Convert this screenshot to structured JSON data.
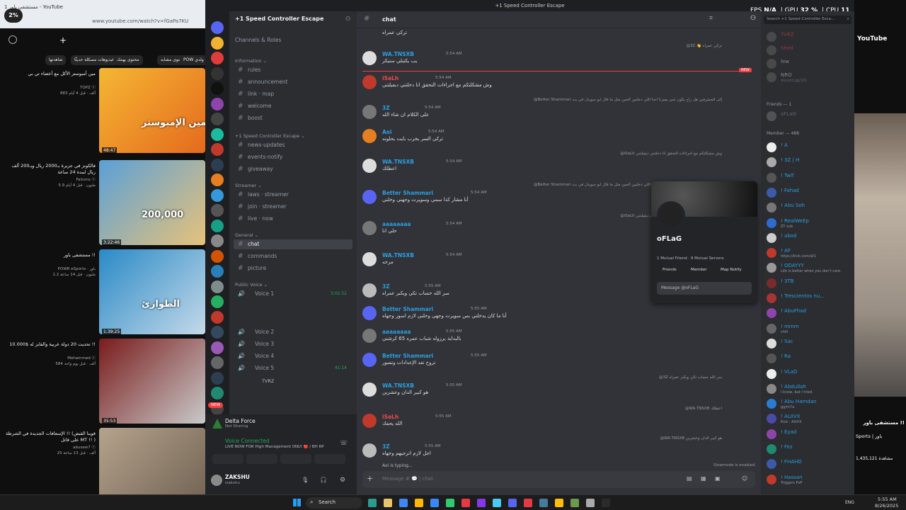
{
  "yt_left": {
    "percent": "2%",
    "tab_title": "مستشفى باور 1 - YouTube",
    "url": "www.youtube.com/watch?v=fGaPa7KU",
    "chips": [
      "شاهدتها",
      "فيديوهات مسكلة حديثًا",
      "محتوى يهمك",
      "محتوى مشابه",
      "POW ولدي"
    ],
    "videos": [
      {
        "duration": "48:47",
        "title": "مين أمبوستر الأكل مع أعضاء تي بي",
        "channel": "TOPZ ⓔ",
        "meta": "883 ألف · قبل 4 أيام",
        "thumb_text": "مين الإمبوستر!"
      },
      {
        "duration": "3:22:46",
        "title": "فالكونز في جزيرة بـ2000 ريال وبـ200 ألف ريال لمدة 24 ساعة",
        "channel": "Falcons ⓔ",
        "meta": "5.9 مليون · قبل 4 أيام",
        "thumb_text": "200,000"
      },
      {
        "duration": "1:39:25",
        "title": "مستشفى باور !!",
        "channel": "POWR eSports · باور",
        "meta": "1.2 مليون · قبل 14 ساعة",
        "thumb_text": "الطوارئ"
      },
      {
        "duration": "35:53",
        "title": "تحديت 20 دولة عربية والفايز له $10.000 !!",
        "channel": "Mohammed ⓔ",
        "meta": "584 ألف · قبل يوم واحد",
        "thumb_text": ""
      },
      {
        "duration": "",
        "title": "الإسعافات الجديدة في الشرطة !! (قوبنا القبض على قاتل MT !! )",
        "channel": "abusew7 ⓔ",
        "meta": "25 ألف · قبل 13 ساعة",
        "thumb_text": ""
      }
    ]
  },
  "discord": {
    "window_title": "+1 Speed Controller Escape",
    "server_name": "+1 Speed Controller Escape",
    "channels_roles": "Channels & Roles",
    "categories": [
      {
        "name": "Information ⌄",
        "channels": [
          "rules",
          "announcement",
          "link · map",
          "welcome",
          "boost"
        ]
      },
      {
        "name": "+1 Speed Controller Escape ⌄",
        "channels": [
          "news-updates",
          "events-notify",
          "giveaway"
        ]
      },
      {
        "name": "Streamer ⌄",
        "channels": [
          "laws · streamer",
          "join · streamer",
          "live · now"
        ]
      },
      {
        "name": "General ⌄",
        "channels": [
          "chat",
          "commands",
          "picture"
        ]
      }
    ],
    "public_voice": "Public Voice ⌄",
    "voice": [
      {
        "name": "Voice 1",
        "time": "3:02:52"
      },
      {
        "name": "Voice 2",
        "time": ""
      },
      {
        "name": "Voice 3",
        "time": ""
      },
      {
        "name": "Voice 4",
        "time": ""
      },
      {
        "name": "Voice 5",
        "time": "41:14"
      }
    ],
    "voice_user": "TVRZ",
    "game": {
      "name": "Delta Force",
      "status": "Not Sharing"
    },
    "voice_connected": "Voice Connected",
    "voice_sub": "LIVE NOW FOR High Management ONLY 🔴 / BH RP",
    "user": {
      "name": "ZAKSHU",
      "handle": "izakshu"
    },
    "new_badge": "NEW",
    "chat_channel": "chat",
    "messages": [
      {
        "reply": "",
        "name": "",
        "time": "",
        "text": "تركي عمراه",
        "color": "#dbdee1"
      },
      {
        "reply": "@3Z 👋 تركي عمراه",
        "name": "WA.TNSXB",
        "time": "5:54 AM",
        "text": "يب يكتبلي ستيكر",
        "color": "#2b9fdf"
      },
      {
        "reply": "",
        "name": "iSaLh",
        "time": "5:54 AM",
        "text": "وش مشكلتكم مع اجراءات التحقق انا دخلتني ديفيلتني",
        "color": "#f04a4a"
      },
      {
        "reply": "@Better Shammari إلى المشرفين هل راح يكون شي يميزنا احنا اللي دخلنين الحين مثل ما قال أبو سويدل في بث",
        "name": "3Z",
        "time": "5:54 AM",
        "text": "على الكلام ان شاء الله",
        "color": "#2b9fdf"
      },
      {
        "reply": "",
        "name": "Aoi",
        "time": "5:54 AM",
        "text": "تركي السر يخرب بايت يحلونه",
        "color": "#2b9fdf"
      },
      {
        "reply": "@iSaLh وش مشكلتكم مع اجراءات التحقق انا دخلتني ديفيلتني",
        "name": "WA.TNSXB",
        "time": "5:54 AM",
        "text": "اعطلك",
        "color": "#2b9fdf"
      },
      {
        "reply": "@Better Shammari إلى المشرفين هل راح يكون شي يميزنا احنا اللي دخلنين الحين مثل ما قال أبو سويدل في بث",
        "name": "Better Shammari",
        "time": "5:54 AM",
        "text": "أنا مشار كذا سمي وسويرت وجهني وخلني",
        "color": "#2b9fdf"
      },
      {
        "reply": "@iSaLh وش مشكلتكم مع اجراءات التحقق انا دخلتني ديفيلتني",
        "name": "aaaaaaaa",
        "time": "5:54 AM",
        "text": "حلي انا",
        "color": "#2b9fdf"
      },
      {
        "reply": "@Aoi تركي السر يخرب بايت يحلونه",
        "name": "WA.TNSXB",
        "time": "5:54 AM",
        "text": "مرحه",
        "color": "#2b9fdf"
      },
      {
        "reply": "@WA.TNSXB يب يكتبلي ستيكر",
        "name": "3Z",
        "time": "5:55 AM",
        "text": "سر الله حساب تكي ويكبر عمراه",
        "color": "#2b9fdf"
      },
      {
        "reply": "",
        "name": "Better Shammari",
        "time": "5:55 AM",
        "text": "أنا ما كان يدخلني بس سويرت وجهي وخلني لازم اسور وجهاه",
        "color": "#2b9fdf"
      },
      {
        "reply": "",
        "name": "aaaaaaaa",
        "time": "5:55 AM",
        "text": "بالبداية يرزوله شباب عمره 65 كرشني",
        "color": "#2b9fdf"
      },
      {
        "reply": "",
        "name": "Better Shammari",
        "time": "5:55 AM",
        "text": "تروح تعد الإعدادات وتسور",
        "color": "#2b9fdf"
      },
      {
        "reply": "@3Z سر الله حساب تكي ويكبر عمراه",
        "name": "WA.TNSXB",
        "time": "5:55 AM",
        "text": "هو كبير الدان وعشرين",
        "color": "#2b9fdf"
      },
      {
        "reply": "@WA.TNSXB اعطلك",
        "name": "iSaLh",
        "time": "5:55 AM",
        "text": "الله يحفك",
        "color": "#f04a4a"
      },
      {
        "reply": "@WA.TNSXB هو كبير الدان وعشرين",
        "name": "3Z",
        "time": "5:55 AM",
        "text": "اجل لازم اترجيهم وجهاه",
        "color": "#2b9fdf"
      }
    ],
    "typing": "Aoi is typing...",
    "slowmode": "Slowmode is enabled.",
    "input_placeholder": "Message # 💬 | chat",
    "profile": {
      "name": "oFLaG",
      "mutual": "1 Mutual Friend · 9 Mutual Servers",
      "tabs": [
        "Friends",
        "Member",
        "Map Notify"
      ],
      "message": "Message @oFLaG"
    },
    "friends_label": "Friends — 1",
    "members_label": "Member — 488",
    "top_members": [
      {
        "name": "TVRZ",
        "status": "",
        "color": "#f04a4a"
      },
      {
        "name": "Shed",
        "status": "",
        "color": "#f04a4a"
      },
      {
        "name": "lew",
        "status": "",
        "color": "#dbdee1"
      },
      {
        "name": "NRO",
        "status": "discord.gg/161",
        "color": "#dbdee1"
      }
    ],
    "friend": {
      "name": "oFLaG",
      "color": "#949ba4"
    },
    "member_list": [
      {
        "name": "! A",
        "status": "",
        "color": "#2b9fdf"
      },
      {
        "name": "! 3Z | H",
        "status": "",
        "color": "#2b9fdf"
      },
      {
        "name": "! Twlf",
        "status": "",
        "color": "#2b9fdf"
      },
      {
        "name": "! Fahad",
        "status": "",
        "color": "#2b9fdf"
      },
      {
        "name": "! Abu Soh",
        "status": "",
        "color": "#2b9fdf"
      },
      {
        "name": "! RealWeEp",
        "status": "ZY sub",
        "color": "#2b9fdf"
      },
      {
        "name": "! abod",
        "status": "",
        "color": "#2b9fdf"
      },
      {
        "name": "! AF",
        "status": "https://kick.com/af1",
        "color": "#2b9fdf"
      },
      {
        "name": "! ODAYYY",
        "status": "Life is better when you don't care.",
        "color": "#2b9fdf"
      },
      {
        "name": "! 3TB",
        "status": "",
        "color": "#2b9fdf"
      },
      {
        "name": "! Trescientos nu...",
        "status": "",
        "color": "#2b9fdf"
      },
      {
        "name": "! AbuFhad",
        "status": "",
        "color": "#2b9fdf"
      },
      {
        "name": "! mmm",
        "status": "chill",
        "color": "#2b9fdf"
      },
      {
        "name": "! Sac",
        "status": "",
        "color": "#2b9fdf"
      },
      {
        "name": "! Ra",
        "status": "",
        "color": "#2b9fdf"
      },
      {
        "name": "! VLaD",
        "status": "",
        "color": "#2b9fdf"
      },
      {
        "name": "! Abdullah",
        "status": "I know, but I tried.",
        "color": "#2b9fdf"
      },
      {
        "name": "! Abu Hamdan",
        "status": "gg/m7a",
        "color": "#2b9fdf"
      },
      {
        "name": "! ALIIVX",
        "status": "Kick : AliiVX",
        "color": "#2b9fdf"
      },
      {
        "name": "! Eyad",
        "status": "",
        "color": "#2b9fdf"
      },
      {
        "name": "! Fez",
        "status": "",
        "color": "#2b9fdf"
      },
      {
        "name": "! FHAHD",
        "status": "",
        "color": "#2b9fdf"
      },
      {
        "name": "! Hassan",
        "status": "Triggers PvP",
        "color": "#2b9fdf"
      }
    ],
    "search_placeholder": "Search +1 Speed Controller Esca...",
    "overlay": {
      "fps_label": "FPS",
      "fps": "N/A",
      "gpu_label": "GPU",
      "gpu": "32 %",
      "cpu_label": "CPU",
      "cpu": "11"
    }
  },
  "yt_right": {
    "logo": "YouTube",
    "title": "مستشفى باور !!",
    "channel": "Sports | باور",
    "views": "1,435,121 مشاهدة"
  },
  "taskbar": {
    "search": "Search",
    "lang": "ENG",
    "time": "5:55 AM",
    "date": "8/26/2025"
  }
}
